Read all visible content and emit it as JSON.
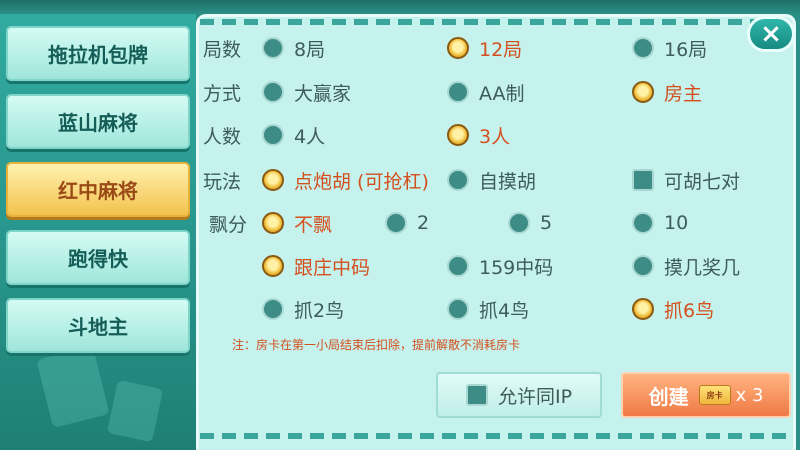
{
  "tabs": [
    {
      "label": "拖拉机包牌",
      "active": false
    },
    {
      "label": "蓝山麻将",
      "active": false
    },
    {
      "label": "红中麻将",
      "active": true
    },
    {
      "label": "跑得快",
      "active": false
    },
    {
      "label": "斗地主",
      "active": false
    }
  ],
  "close_icon": "×",
  "rows": {
    "rounds": {
      "label": "局数",
      "options": [
        "8局",
        "12局",
        "16局"
      ],
      "selected": "12局"
    },
    "mode": {
      "label": "方式",
      "options": [
        "大赢家",
        "AA制",
        "房主"
      ],
      "selected": "房主"
    },
    "players": {
      "label": "人数",
      "options": [
        "4人",
        "3人"
      ],
      "selected": "3人"
    },
    "play": {
      "label": "玩法",
      "options": [
        "点炮胡 (可抢杠)",
        "自摸胡",
        "可胡七对"
      ],
      "selected": [
        "点炮胡 (可抢杠)"
      ]
    },
    "piao": {
      "label": "飘分",
      "options": [
        "不飘",
        "2",
        "5",
        "10"
      ],
      "selected": "不飘"
    },
    "ma": {
      "options": [
        "跟庄中码",
        "159中码",
        "摸几奖几"
      ],
      "selected": "跟庄中码"
    },
    "bird": {
      "options": [
        "抓2鸟",
        "抓4鸟",
        "抓6鸟"
      ],
      "selected": "抓6鸟"
    }
  },
  "note": "注：房卡在第一小局结束后扣除，提前解散不消耗房卡",
  "allow_ip": {
    "label": "允许同IP",
    "checked": false
  },
  "create": {
    "label": "创建",
    "card_icon_text": "房卡",
    "multiplier": "x 3"
  },
  "colors": {
    "accent": "#f2c24e",
    "selected_text": "#d3501e",
    "panel": "#c6f2ee"
  }
}
